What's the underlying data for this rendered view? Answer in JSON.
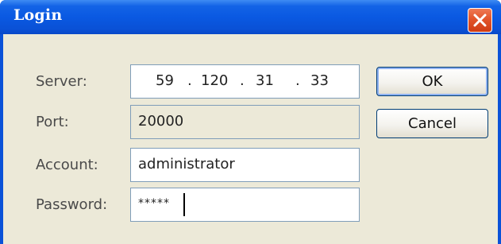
{
  "dialog": {
    "title": "Login",
    "close_icon": "close-icon"
  },
  "fields": {
    "server": {
      "label": "Server:",
      "octets": [
        "59",
        "120",
        "31",
        "33"
      ],
      "separator": "."
    },
    "port": {
      "label": "Port:",
      "value": "20000"
    },
    "account": {
      "label": "Account:",
      "value": "administrator"
    },
    "password": {
      "label": "Password:",
      "value": "*****"
    }
  },
  "buttons": {
    "ok_label": "OK",
    "cancel_label": "Cancel"
  },
  "colors": {
    "titlebar": "#0a52d8",
    "close_button": "#e2552b",
    "dialog_bg": "#ece9d8"
  }
}
